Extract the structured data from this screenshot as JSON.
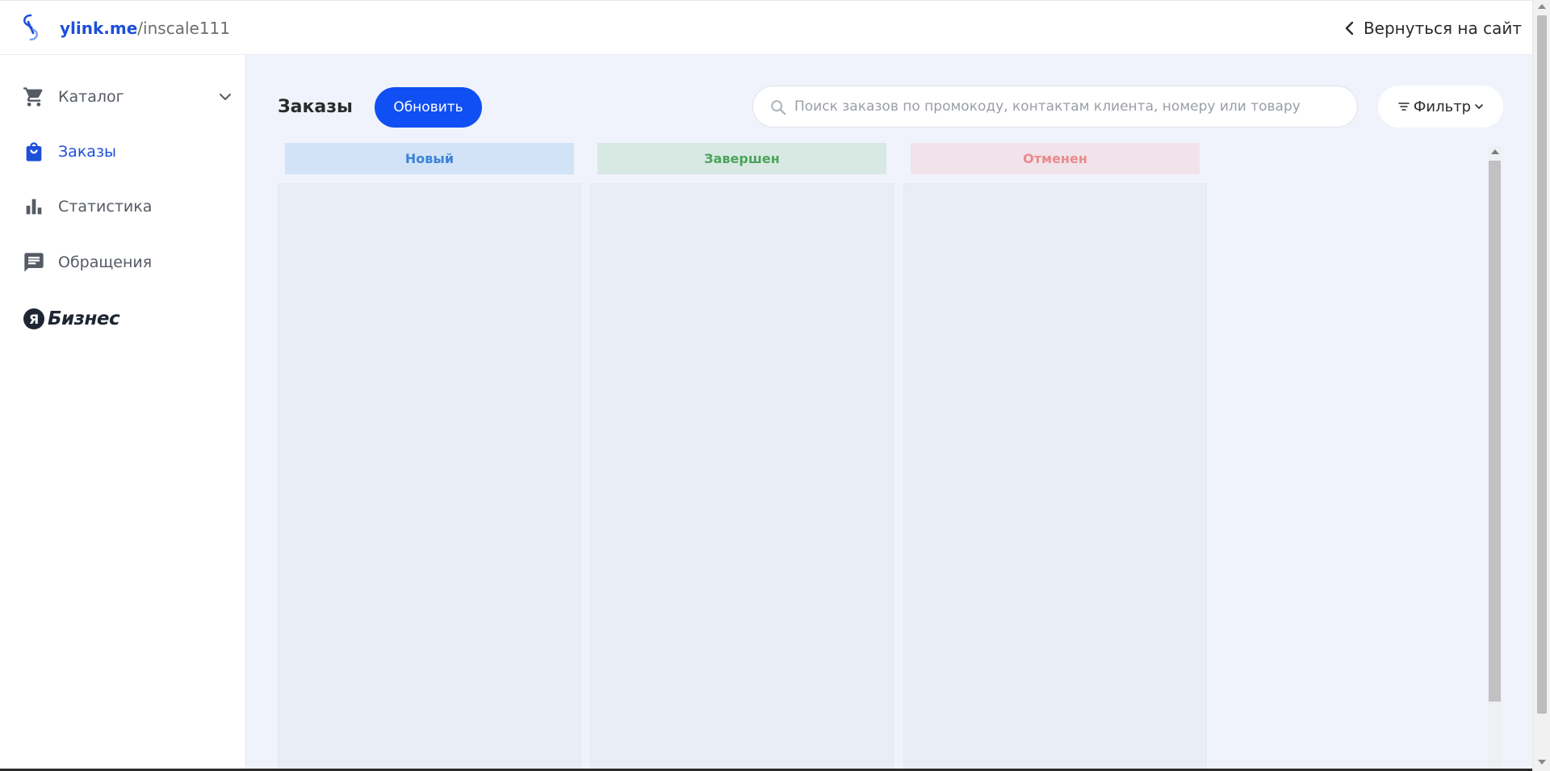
{
  "header": {
    "brand_domain": "ylink.me",
    "brand_slash": "/",
    "brand_user": "inscale111",
    "back_label": "Вернуться на сайт"
  },
  "sidebar": {
    "items": [
      {
        "label": "Каталог",
        "icon": "cart-icon",
        "active": false,
        "expandable": true
      },
      {
        "label": "Заказы",
        "icon": "shopping-bag-icon",
        "active": true
      },
      {
        "label": "Статистика",
        "icon": "bar-chart-icon",
        "active": false
      },
      {
        "label": "Обращения",
        "icon": "message-icon",
        "active": false
      }
    ],
    "business_badge": "Я",
    "business_text": "Бизнес"
  },
  "main": {
    "title": "Заказы",
    "refresh_label": "Обновить",
    "search_placeholder": "Поиск заказов по промокоду, контактам клиента, номеру или товару",
    "filter_label": "Фильтр",
    "columns": [
      {
        "label": "Новый",
        "text_color": "#3b82d8",
        "bg_color": "#d3e3f7"
      },
      {
        "label": "Завершен",
        "text_color": "#4ca35a",
        "bg_color": "#d8e9e3"
      },
      {
        "label": "Отменен",
        "text_color": "#e98b8b",
        "bg_color": "#f1e3ea"
      }
    ]
  },
  "colors": {
    "accent": "#0f4ff3",
    "brand_blue": "#1e4fd8",
    "main_bg": "#f0f3fb",
    "column_bg": "#e9edf6"
  }
}
